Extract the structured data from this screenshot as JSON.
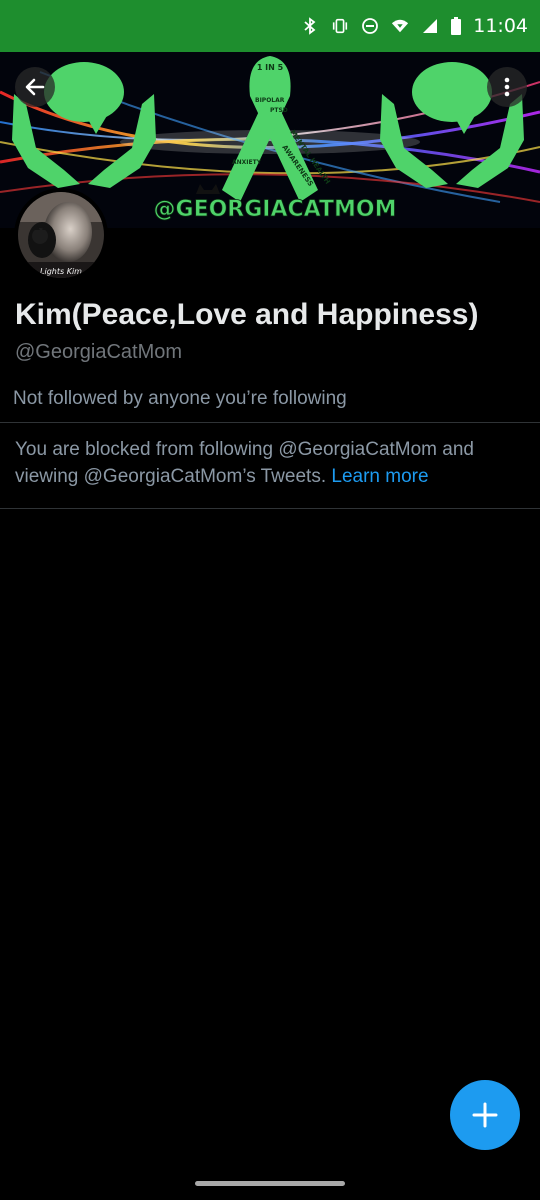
{
  "status_bar": {
    "time": "11:04",
    "icons": [
      "bluetooth-icon",
      "vibrate-icon",
      "do-not-disturb-icon",
      "wifi-icon",
      "cellular-signal-icon",
      "battery-icon"
    ],
    "background": "#1e8e2e"
  },
  "banner": {
    "watermark_text": "@GEORGIACATMOM",
    "ribbon_text": [
      "1 IN 5",
      "MENTAL HEALTH",
      "AWARENESS",
      "BIPOLAR",
      "ANXIETY",
      "PTSD"
    ],
    "accent_color": "#4fd36a"
  },
  "avatar": {
    "caption": "Lights Kim"
  },
  "profile": {
    "display_name": "Kim(Peace,Love and Happiness)",
    "handle": "@GeorgiaCatMom",
    "follow_context": "Not followed by anyone you’re following"
  },
  "blocked": {
    "message": "You are blocked from following @GeorgiaCatMom and viewing @GeorgiaCatMom’s Tweets.",
    "learn_more": "Learn more"
  },
  "colors": {
    "link": "#1d9bf0",
    "fab": "#1d9bf0"
  }
}
